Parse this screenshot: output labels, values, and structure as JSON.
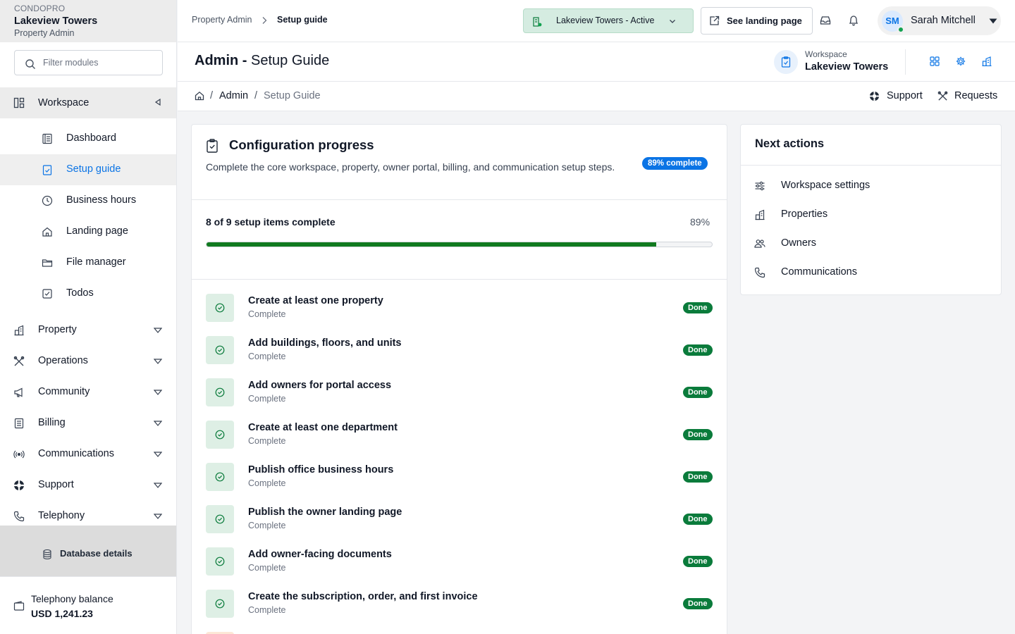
{
  "sidebar": {
    "brand": "CONDOPRO",
    "workspace_name": "Lakeview Towers",
    "role": "Property Admin",
    "filter_placeholder": "Filter modules",
    "workspace_group": {
      "label": "Workspace",
      "items": [
        {
          "label": "Dashboard",
          "icon": "dashboard-icon"
        },
        {
          "label": "Setup guide",
          "icon": "clipboard-check-icon",
          "active": true
        },
        {
          "label": "Business hours",
          "icon": "clock-icon"
        },
        {
          "label": "Landing page",
          "icon": "home-icon"
        },
        {
          "label": "File manager",
          "icon": "folder-icon"
        },
        {
          "label": "Todos",
          "icon": "checkbox-icon"
        }
      ]
    },
    "sections": [
      {
        "label": "Property",
        "icon": "building-icon"
      },
      {
        "label": "Operations",
        "icon": "tools-icon"
      },
      {
        "label": "Community",
        "icon": "megaphone-icon"
      },
      {
        "label": "Billing",
        "icon": "billing-icon"
      },
      {
        "label": "Communications",
        "icon": "broadcast-icon"
      },
      {
        "label": "Support",
        "icon": "lifebuoy-icon"
      },
      {
        "label": "Telephony",
        "icon": "phone-icon"
      }
    ],
    "database_details": "Database details",
    "balance_label": "Telephony balance",
    "balance_value": "USD 1,241.23"
  },
  "topbar": {
    "crumb_parent": "Property Admin",
    "crumb_current": "Setup guide",
    "workspace_select": "Lakeview Towers - Active",
    "landing_button": "See landing page",
    "user_initials": "SM",
    "user_name": "Sarah Mitchell"
  },
  "header": {
    "title_bold": "Admin -",
    "title_rest": "Setup Guide",
    "workspace_caption": "Workspace",
    "workspace_name": "Lakeview Towers"
  },
  "breadcrumb": {
    "separator": "/",
    "admin": "Admin",
    "current": "Setup Guide",
    "support": "Support",
    "requests": "Requests"
  },
  "config": {
    "title": "Configuration progress",
    "description": "Complete the core workspace, property, owner portal, billing, and communication setup steps.",
    "badge": "89% complete",
    "count_text": "8 of 9 setup items complete",
    "percent_text": "89%",
    "progress_fraction": 0.89,
    "tasks": [
      {
        "title": "Create at least one property",
        "status": "Complete",
        "badge": "Done"
      },
      {
        "title": "Add buildings, floors, and units",
        "status": "Complete",
        "badge": "Done"
      },
      {
        "title": "Add owners for portal access",
        "status": "Complete",
        "badge": "Done"
      },
      {
        "title": "Create at least one department",
        "status": "Complete",
        "badge": "Done"
      },
      {
        "title": "Publish office business hours",
        "status": "Complete",
        "badge": "Done"
      },
      {
        "title": "Publish the owner landing page",
        "status": "Complete",
        "badge": "Done"
      },
      {
        "title": "Add owner-facing documents",
        "status": "Complete",
        "badge": "Done"
      },
      {
        "title": "Create the subscription, order, and first invoice",
        "status": "Complete",
        "badge": "Done"
      }
    ]
  },
  "next_actions": {
    "title": "Next actions",
    "items": [
      {
        "label": "Workspace settings",
        "icon": "sliders-icon"
      },
      {
        "label": "Properties",
        "icon": "building-icon"
      },
      {
        "label": "Owners",
        "icon": "users-icon"
      },
      {
        "label": "Communications",
        "icon": "phone-icon"
      }
    ]
  },
  "colors": {
    "accent": "#0b74e5",
    "success": "#0a7b3b",
    "progress_fill": "#117a1f",
    "active_workspace_bg": "#d5ece1"
  }
}
